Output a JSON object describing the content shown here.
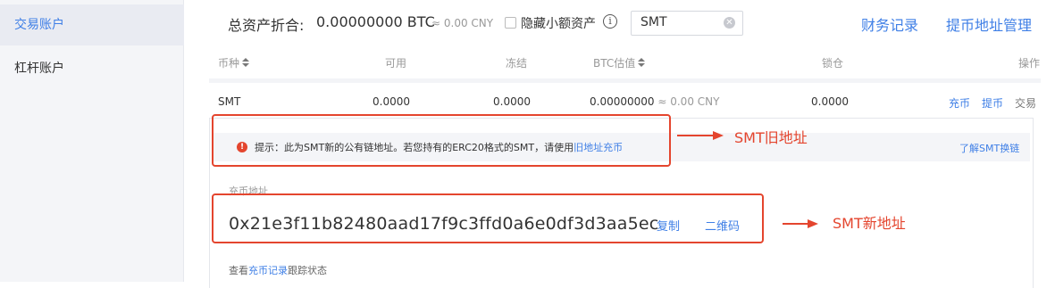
{
  "sidebar": {
    "items": [
      {
        "label": "交易账户"
      },
      {
        "label": "杠杆账户"
      }
    ]
  },
  "header": {
    "total_label": "总资产折合:",
    "total_value": "0.00000000 BTC",
    "total_cny": "≈ 0.00 CNY",
    "hide_small_label": "隐藏小额资产",
    "info_icon": "i",
    "search_value": "SMT",
    "finance_link": "财务记录",
    "address_mgmt_link": "提币地址管理"
  },
  "table": {
    "headers": {
      "currency": "币种",
      "available": "可用",
      "frozen": "冻结",
      "btc_value": "BTC估值",
      "locked": "锁仓",
      "actions": "操作"
    },
    "row": {
      "currency": "SMT",
      "available": "0.0000",
      "frozen": "0.0000",
      "btc_value": "0.00000000",
      "cny_value": "≈ 0.00 CNY",
      "locked": "0.0000",
      "action_deposit": "充币",
      "action_withdraw": "提币",
      "action_trade": "交易"
    }
  },
  "panel": {
    "warn_icon": "!",
    "notice_prefix": "提示：此为SMT新的公有链地址。若您持有的ERC20格式的SMT，请使用",
    "notice_link": "旧地址充币",
    "learn_link": "了解SMT换链",
    "deposit_label": "充币地址",
    "address": "0x21e3f11b82480aad17f9c3ffd0a6e0df3d3aa5ec",
    "copy_label": "复制",
    "qr_label": "二维码",
    "footer_prefix": "查看",
    "footer_link": "充币记录",
    "footer_suffix": "跟踪状态"
  },
  "annotations": {
    "old_address": "SMT旧地址",
    "new_address": "SMT新地址",
    "color": "#e4452e"
  },
  "colors": {
    "accent": "#3f7fe6",
    "sidebar_bg": "#f4f5f8"
  }
}
